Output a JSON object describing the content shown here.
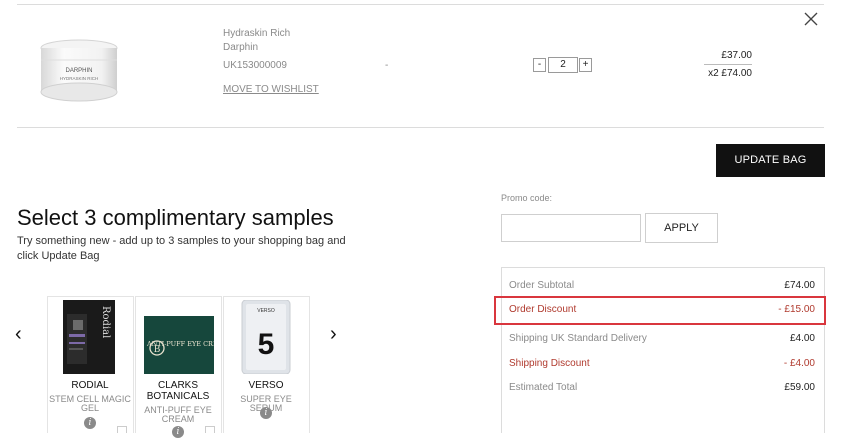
{
  "product": {
    "name": "Hydraskin Rich",
    "brand": "Darphin",
    "sku": "UK153000009",
    "variant": "-",
    "wishlist_label": "MOVE TO WISHLIST",
    "quantity": "2",
    "qty_minus": "-",
    "qty_plus": "+",
    "unit_price": "£37.00",
    "line_total": "x2 £74.00",
    "image_brand": "DARPHIN",
    "image_name": "HYDRASKIN RICH"
  },
  "cart": {
    "update_label": "UPDATE BAG",
    "close_icon": "close-icon"
  },
  "samples": {
    "title": "Select 3 complimentary samples",
    "subtitle": "Try something new - add up to 3 samples to your shopping bag and click Update Bag",
    "prev": "‹",
    "next": "›",
    "info": "i",
    "items": [
      {
        "brand": "RODIAL",
        "product": "STEM CELL MAGIC GEL",
        "logo": "Rodial"
      },
      {
        "brand": "CLARKS BOTANICALS",
        "product": "ANTI-PUFF EYE CREAM",
        "logo": "ANTI-PUFF EYE CREAM"
      },
      {
        "brand": "VERSO",
        "product": "SUPER EYE SERUM",
        "logo": "5"
      }
    ]
  },
  "promo": {
    "label": "Promo code:",
    "input_value": "",
    "apply_label": "APPLY"
  },
  "summary": {
    "subtotal_label": "Order Subtotal",
    "subtotal_value": "£74.00",
    "discount_label": "Order Discount",
    "discount_value": "- £15.00",
    "delivery_label": "Shipping UK Standard Delivery",
    "delivery_value": "£4.00",
    "ship_discount_label": "Shipping Discount",
    "ship_discount_value": "- £4.00",
    "total_label": "Estimated Total",
    "total_value": "£59.00"
  },
  "colors": {
    "accent_dark": "#111111",
    "discount_red": "#b03a2e",
    "highlight_red": "#d9363e"
  }
}
